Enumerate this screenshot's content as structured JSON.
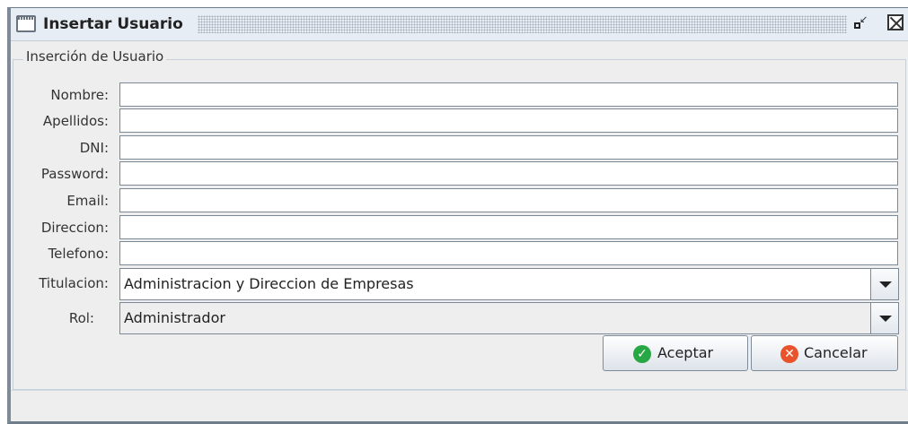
{
  "window": {
    "title": "Insertar Usuario"
  },
  "titlebar_icons": {
    "window": "window-icon",
    "restore": "restore-icon",
    "close": "close-icon"
  },
  "group": {
    "legend": "Inserción de Usuario"
  },
  "form": {
    "nombre_label": "Nombre:",
    "nombre_value": "",
    "apellidos_label": "Apellidos:",
    "apellidos_value": "",
    "dni_label": "DNI:",
    "dni_value": "",
    "password_label": "Password:",
    "password_value": "",
    "email_label": "Email:",
    "email_value": "",
    "direccion_label": "Direccion:",
    "direccion_value": "",
    "telefono_label": "Telefono:",
    "telefono_value": "",
    "titulacion_label": "Titulacion:",
    "titulacion_value": "Administracion y Direccion de Empresas",
    "rol_label": "Rol:",
    "rol_value": "Administrador"
  },
  "buttons": {
    "accept": "Aceptar",
    "cancel": "Cancelar"
  },
  "colors": {
    "accept_icon": "#27a844",
    "cancel_icon": "#e8532b",
    "accent": "#7f8a96"
  }
}
